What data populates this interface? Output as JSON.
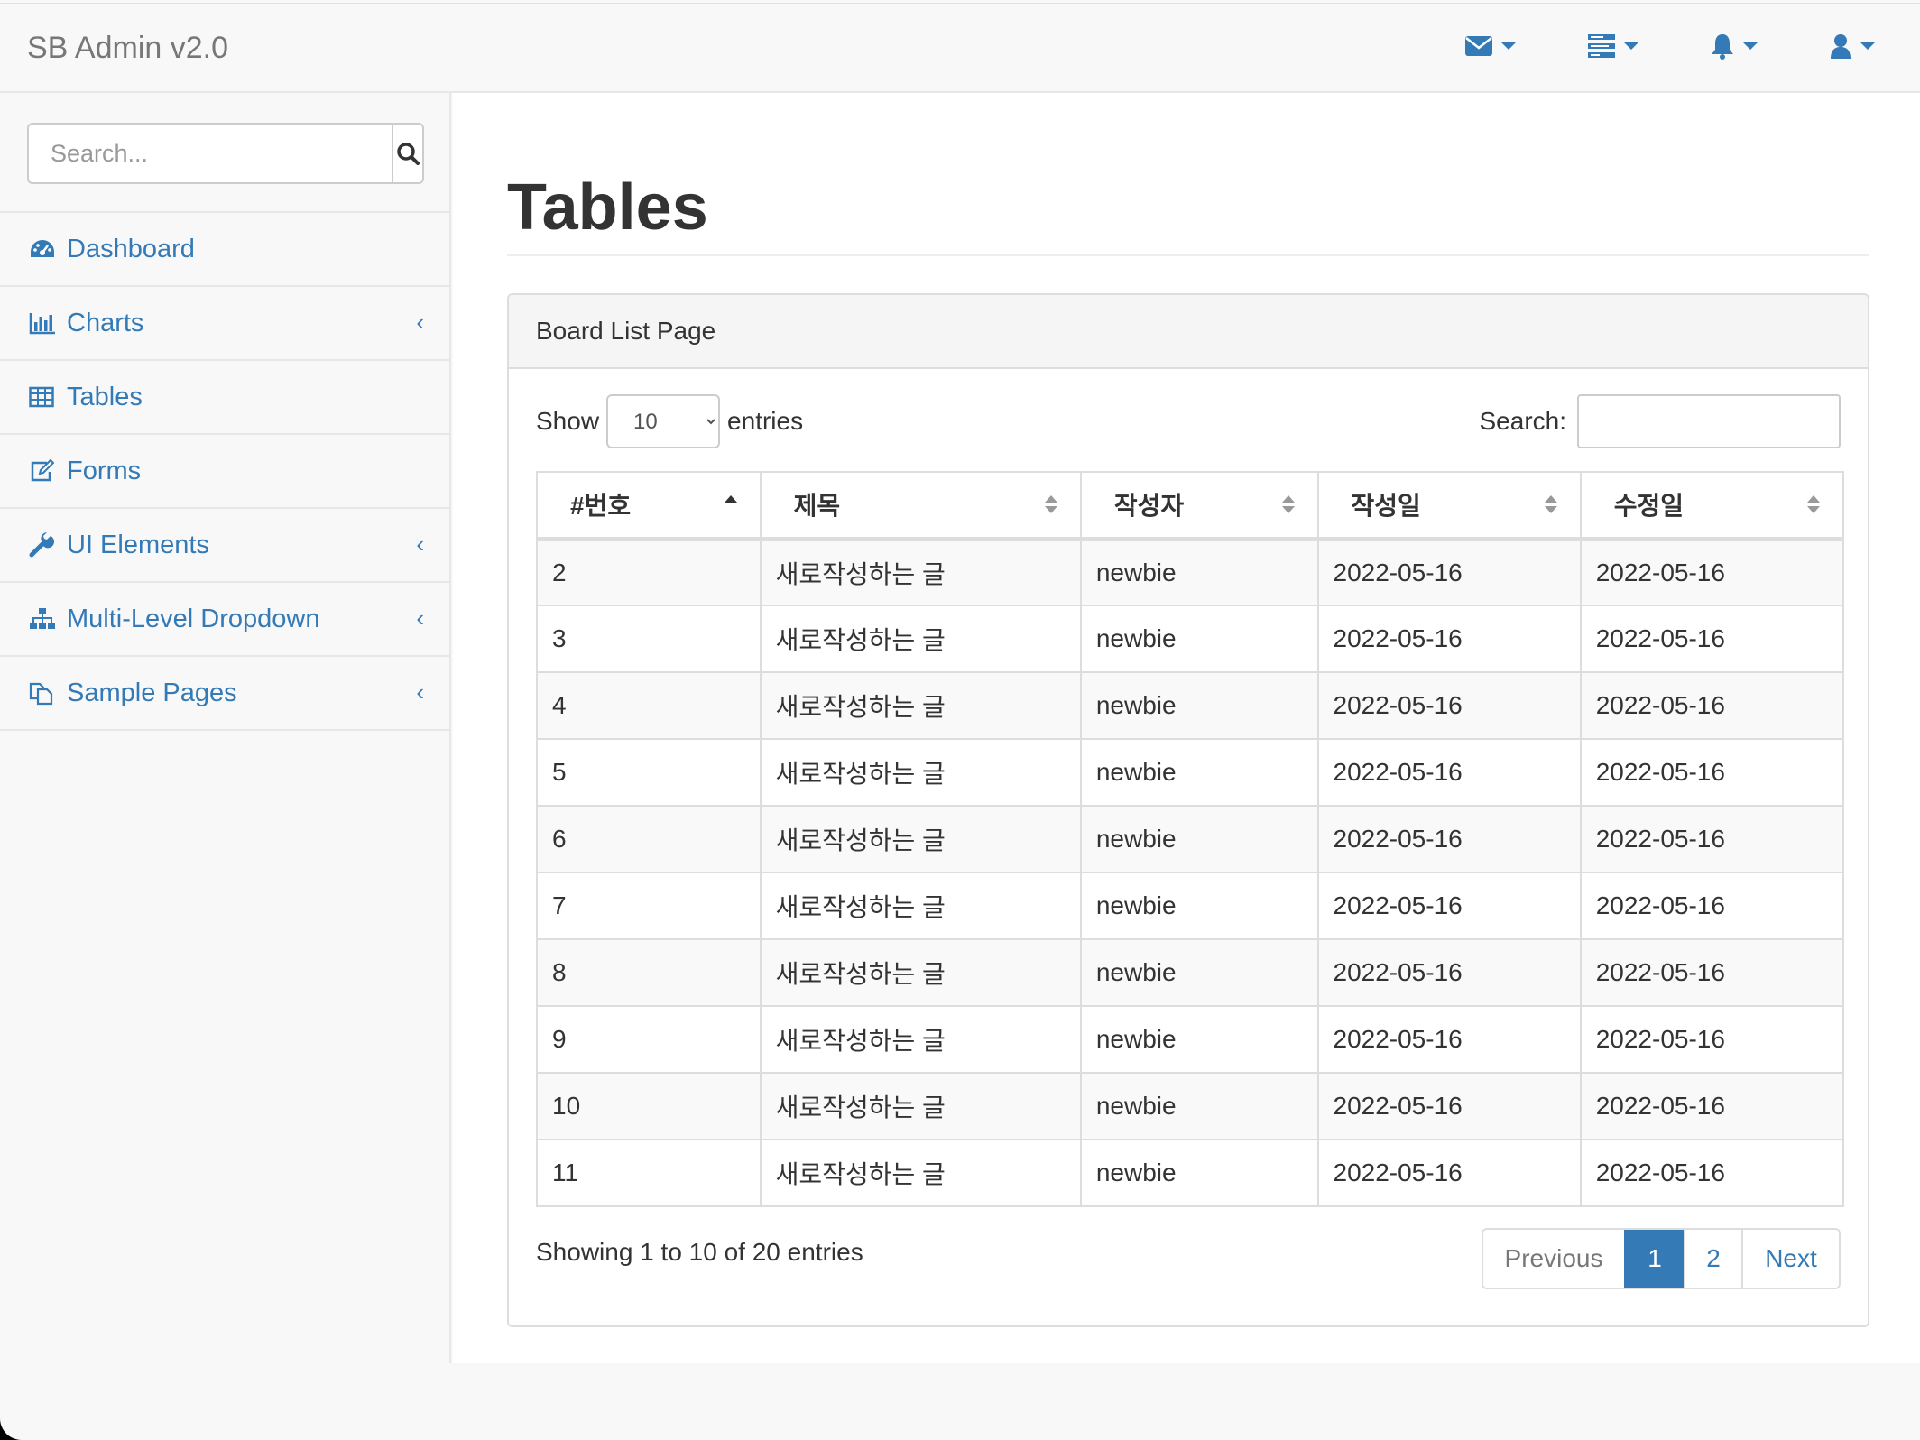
{
  "navbar": {
    "brand": "SB Admin v2.0",
    "icons": [
      "envelope-icon",
      "tasks-icon",
      "bell-icon",
      "user-icon"
    ],
    "accent_color": "#337ab7"
  },
  "sidebar": {
    "search_placeholder": "Search...",
    "items": [
      {
        "label": "Dashboard",
        "icon": "dashboard-icon",
        "has_arrow": false
      },
      {
        "label": "Charts",
        "icon": "bar-chart-icon",
        "has_arrow": true
      },
      {
        "label": "Tables",
        "icon": "table-icon",
        "has_arrow": false
      },
      {
        "label": "Forms",
        "icon": "edit-icon",
        "has_arrow": false
      },
      {
        "label": "UI Elements",
        "icon": "wrench-icon",
        "has_arrow": true
      },
      {
        "label": "Multi-Level Dropdown",
        "icon": "sitemap-icon",
        "has_arrow": true
      },
      {
        "label": "Sample Pages",
        "icon": "files-icon",
        "has_arrow": true
      }
    ],
    "arrow_glyph": "‹"
  },
  "main": {
    "title": "Tables",
    "panel": {
      "heading": "Board List Page",
      "show_label": "Show",
      "entries_label": "entries",
      "length_value": "10",
      "search_label": "Search:",
      "columns": [
        "#번호",
        "제목",
        "작성자",
        "작성일",
        "수정일"
      ],
      "rows": [
        [
          "2",
          "새로작성하는 글",
          "newbie",
          "2022-05-16",
          "2022-05-16"
        ],
        [
          "3",
          "새로작성하는 글",
          "newbie",
          "2022-05-16",
          "2022-05-16"
        ],
        [
          "4",
          "새로작성하는 글",
          "newbie",
          "2022-05-16",
          "2022-05-16"
        ],
        [
          "5",
          "새로작성하는 글",
          "newbie",
          "2022-05-16",
          "2022-05-16"
        ],
        [
          "6",
          "새로작성하는 글",
          "newbie",
          "2022-05-16",
          "2022-05-16"
        ],
        [
          "7",
          "새로작성하는 글",
          "newbie",
          "2022-05-16",
          "2022-05-16"
        ],
        [
          "8",
          "새로작성하는 글",
          "newbie",
          "2022-05-16",
          "2022-05-16"
        ],
        [
          "9",
          "새로작성하는 글",
          "newbie",
          "2022-05-16",
          "2022-05-16"
        ],
        [
          "10",
          "새로작성하는 글",
          "newbie",
          "2022-05-16",
          "2022-05-16"
        ],
        [
          "11",
          "새로작성하는 글",
          "newbie",
          "2022-05-16",
          "2022-05-16"
        ]
      ],
      "info": "Showing 1 to 10 of 20 entries",
      "pagination": {
        "previous": "Previous",
        "pages": [
          "1",
          "2"
        ],
        "active_page": "1",
        "next": "Next"
      }
    }
  }
}
